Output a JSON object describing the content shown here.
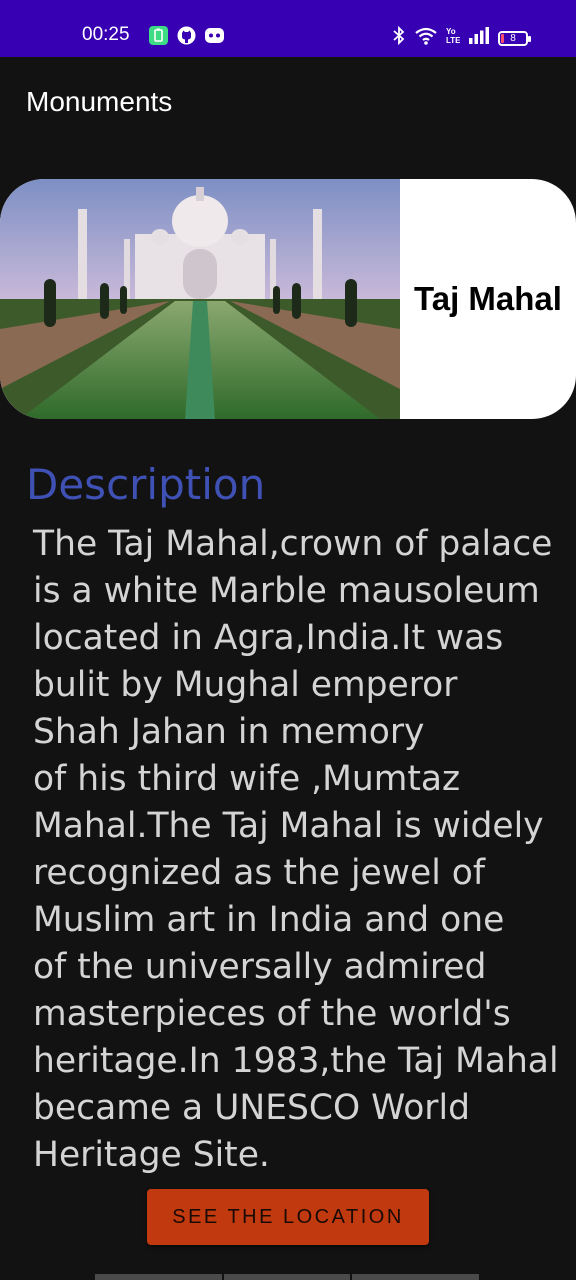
{
  "status_bar": {
    "time": "00:25",
    "battery": "8",
    "color": "#3700b3",
    "icons": [
      "battery-saver-icon",
      "github-icon",
      "game-controller-icon",
      "bluetooth-icon",
      "wifi-icon",
      "volte-icon",
      "signal-icon",
      "battery-icon"
    ]
  },
  "app": {
    "title": "Monuments"
  },
  "hero": {
    "image_alt": "taj-mahal-photo",
    "title": "Taj Mahal"
  },
  "description": {
    "heading": "Description",
    "heading_color": "#3f51b5",
    "text": "The Taj Mahal,crown of palace\nis a white Marble mausoleum\nlocated in Agra,India.It was\nbulit by Mughal emperor\nShah Jahan in memory\nof his third wife ,Mumtaz\nMahal.The Taj Mahal is widely\nrecognized as the jewel of\nMuslim art in India and one\nof the universally admired\nmasterpieces of the world's\nheritage.In 1983,the Taj Mahal\nbecame a UNESCO World\nHeritage Site."
  },
  "actions": {
    "location_label": "SEE THE LOCATION",
    "button_color": "#c0390f"
  }
}
